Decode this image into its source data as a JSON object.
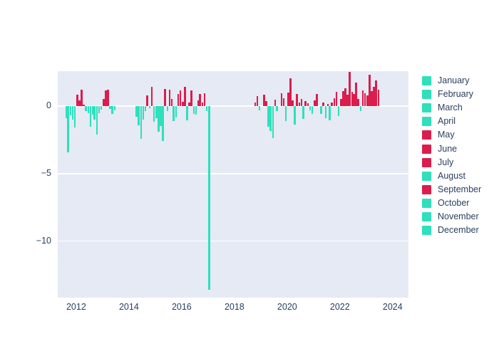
{
  "chart_data": {
    "type": "bar",
    "title": "",
    "xlabel": "",
    "ylabel": "",
    "xlim": [
      2011.3,
      2024.6
    ],
    "ylim": [
      -14.2,
      2.6
    ],
    "yticks": [
      0,
      -5,
      -10
    ],
    "ytick_labels": [
      "0",
      "−5",
      "−10"
    ],
    "xticks": [
      2012,
      2014,
      2016,
      2018,
      2020,
      2022,
      2024
    ],
    "xtick_labels": [
      "2012",
      "2014",
      "2016",
      "2018",
      "2020",
      "2022",
      "2024"
    ],
    "grid": true,
    "legend_position": "right",
    "colors": {
      "positive": "#dc1c4d",
      "negative": "#2ee0bb",
      "plot_background": "#e5eaf4",
      "paper_background": "#ffffff",
      "gridline": "#ffffff",
      "tick_text": "#2a3f5f"
    },
    "legend_entries": [
      {
        "label": "January",
        "color": "#2ee0bb"
      },
      {
        "label": "February",
        "color": "#2ee0bb"
      },
      {
        "label": "March",
        "color": "#2ee0bb"
      },
      {
        "label": "April",
        "color": "#2ee0bb"
      },
      {
        "label": "May",
        "color": "#dc1c4d"
      },
      {
        "label": "June",
        "color": "#dc1c4d"
      },
      {
        "label": "July",
        "color": "#dc1c4d"
      },
      {
        "label": "August",
        "color": "#2ee0bb"
      },
      {
        "label": "September",
        "color": "#dc1c4d"
      },
      {
        "label": "October",
        "color": "#2ee0bb"
      },
      {
        "label": "November",
        "color": "#2ee0bb"
      },
      {
        "label": "December",
        "color": "#2ee0bb"
      }
    ],
    "x": [
      2011.62,
      2011.7,
      2011.79,
      2011.87,
      2011.95,
      2012.04,
      2012.12,
      2012.21,
      2012.29,
      2012.37,
      2012.46,
      2012.54,
      2012.62,
      2012.7,
      2012.79,
      2012.87,
      2012.95,
      2013.04,
      2013.12,
      2013.21,
      2013.29,
      2013.37,
      2013.46,
      2014.29,
      2014.37,
      2014.46,
      2014.54,
      2014.62,
      2014.7,
      2014.79,
      2014.87,
      2014.95,
      2015.04,
      2015.12,
      2015.21,
      2015.29,
      2015.37,
      2015.46,
      2015.54,
      2015.62,
      2015.7,
      2015.79,
      2015.87,
      2015.95,
      2016.04,
      2016.12,
      2016.21,
      2016.29,
      2016.37,
      2016.46,
      2016.54,
      2016.62,
      2016.7,
      2016.79,
      2016.87,
      2016.95,
      2017.04,
      2018.79,
      2018.87,
      2018.95,
      2019.12,
      2019.21,
      2019.29,
      2019.37,
      2019.46,
      2019.54,
      2019.62,
      2019.79,
      2019.87,
      2019.95,
      2020.04,
      2020.12,
      2020.21,
      2020.29,
      2020.37,
      2020.46,
      2020.54,
      2020.62,
      2020.7,
      2020.79,
      2020.87,
      2020.95,
      2021.04,
      2021.12,
      2021.29,
      2021.37,
      2021.46,
      2021.54,
      2021.62,
      2021.7,
      2021.79,
      2021.87,
      2021.95,
      2022.04,
      2022.12,
      2022.21,
      2022.29,
      2022.37,
      2022.46,
      2022.54,
      2022.62,
      2022.7,
      2022.79,
      2022.87,
      2022.95,
      2023.04,
      2023.12,
      2023.21,
      2023.29,
      2023.37,
      2023.46
    ],
    "values": [
      -0.9,
      -3.4,
      -0.7,
      -1.0,
      -1.6,
      0.85,
      0.45,
      1.25,
      0.1,
      -0.35,
      -0.5,
      -1.5,
      -0.6,
      -1.0,
      -2.1,
      -0.5,
      -0.25,
      0.55,
      1.15,
      1.25,
      -0.2,
      -0.55,
      -0.3,
      -0.8,
      -1.4,
      -2.4,
      -1.0,
      -0.35,
      0.8,
      -0.15,
      1.45,
      -1.15,
      -0.9,
      -1.9,
      -1.45,
      -2.6,
      1.3,
      -0.35,
      1.25,
      0.55,
      -1.1,
      -0.85,
      0.9,
      1.2,
      0.35,
      1.45,
      -1.05,
      0.3,
      1.2,
      -0.55,
      -0.6,
      0.45,
      0.9,
      0.25,
      0.95,
      -0.35,
      -13.6,
      0.25,
      0.75,
      -0.3,
      0.85,
      0.4,
      -1.5,
      -1.85,
      -2.35,
      0.5,
      -0.35,
      0.95,
      0.6,
      -1.1,
      1.0,
      2.05,
      0.45,
      -1.35,
      0.9,
      0.3,
      0.55,
      -0.95,
      0.4,
      0.2,
      -0.3,
      -0.55,
      0.45,
      0.9,
      -0.55,
      0.3,
      -0.9,
      0.15,
      -1.05,
      0.25,
      0.6,
      1.05,
      -0.75,
      0.55,
      1.1,
      1.35,
      0.85,
      2.55,
      1.05,
      0.9,
      1.75,
      0.55,
      -0.35,
      1.15,
      0.95,
      0.8,
      2.35,
      1.1,
      1.45,
      1.9,
      1.25
    ]
  }
}
